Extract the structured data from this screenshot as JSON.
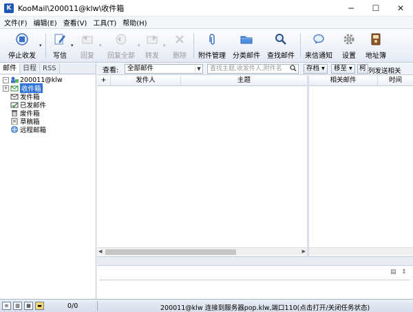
{
  "window": {
    "title": "KooMail\\200011@klw\\收件箱",
    "app_icon_letter": "K",
    "minimize": "─",
    "maximize": "☐",
    "close": "✕"
  },
  "menu": [
    "文件(F)",
    "编辑(E)",
    "查看(V)",
    "工具(T)",
    "帮助(H)"
  ],
  "toolbar": {
    "stop_recv": "停止收发",
    "compose": "写信",
    "reply": "回复",
    "reply_all": "回复全部",
    "forward": "转发",
    "delete": "删除",
    "attachments": "附件管理",
    "classify": "分类邮件",
    "find": "查找邮件",
    "notify": "来信通知",
    "settings": "设置",
    "addressbook": "地址簿",
    "drop_arrow": "▾"
  },
  "sidebar": {
    "tabs": [
      "邮件",
      "日程",
      "RSS"
    ],
    "account": "200011@klw",
    "folders": [
      "收件箱",
      "发件箱",
      "已发邮件",
      "废件箱",
      "草稿箱",
      "远程邮箱"
    ],
    "expand_glyph": "−",
    "child_expand_glyph": "+"
  },
  "filter": {
    "label": "查看:",
    "selected": "全部邮件",
    "search_placeholder": "查找主题,收发件人,附件名",
    "archive_btn": "存档",
    "move_btn": "移至",
    "list_btn": "柯",
    "related_toggle": "列发送相关"
  },
  "list": {
    "columns": [
      "+",
      "发件人",
      "主题"
    ]
  },
  "related": {
    "columns": [
      "相关邮件",
      "时间"
    ]
  },
  "status": {
    "count": "0/0",
    "message": "200011@klw 连接到服务器pop.klw,端口110(点击打开/关闭任务状态)"
  }
}
